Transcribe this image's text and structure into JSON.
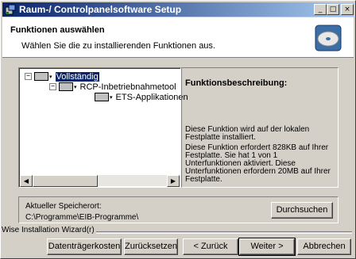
{
  "window": {
    "title": "Raum-/ Controlpanelsoftware Setup",
    "min_label": "_",
    "max_label": "□",
    "close_label": "×"
  },
  "header": {
    "title": "Funktionen auswählen",
    "subtitle": "Wählen Sie die zu installierenden Funktionen aus."
  },
  "tree": {
    "items": [
      {
        "label": "Vollständig",
        "selected": true,
        "expander": "−"
      },
      {
        "label": "RCP-Inbetriebnahmetool",
        "selected": false,
        "expander": "−"
      },
      {
        "label": "ETS-Applikationen",
        "selected": false,
        "expander": ""
      }
    ],
    "scroll_left": "◀",
    "scroll_right": "▶"
  },
  "description": {
    "title": "Funktionsbeschreibung:",
    "line1": "Diese Funktion wird auf der lokalen Festplatte installiert.",
    "line2": "Diese Funktion erfordert 828KB auf Ihrer Festplatte. Sie hat 1 von 1 Unterfunktionen aktiviert. Diese Unterfunktionen erfordern 20MB auf Ihrer Festplatte."
  },
  "location": {
    "label": "Aktueller Speicherort:",
    "path": "C:\\Programme\\EIB-Programme\\",
    "browse_label": "Durchsuchen"
  },
  "footer": {
    "brand": "Wise Installation Wizard(r)",
    "disk_cost": "Datenträgerkosten",
    "reset": "Zurücksetzen",
    "back": "< Zurück",
    "next": "Weiter >",
    "cancel": "Abbrechen"
  }
}
